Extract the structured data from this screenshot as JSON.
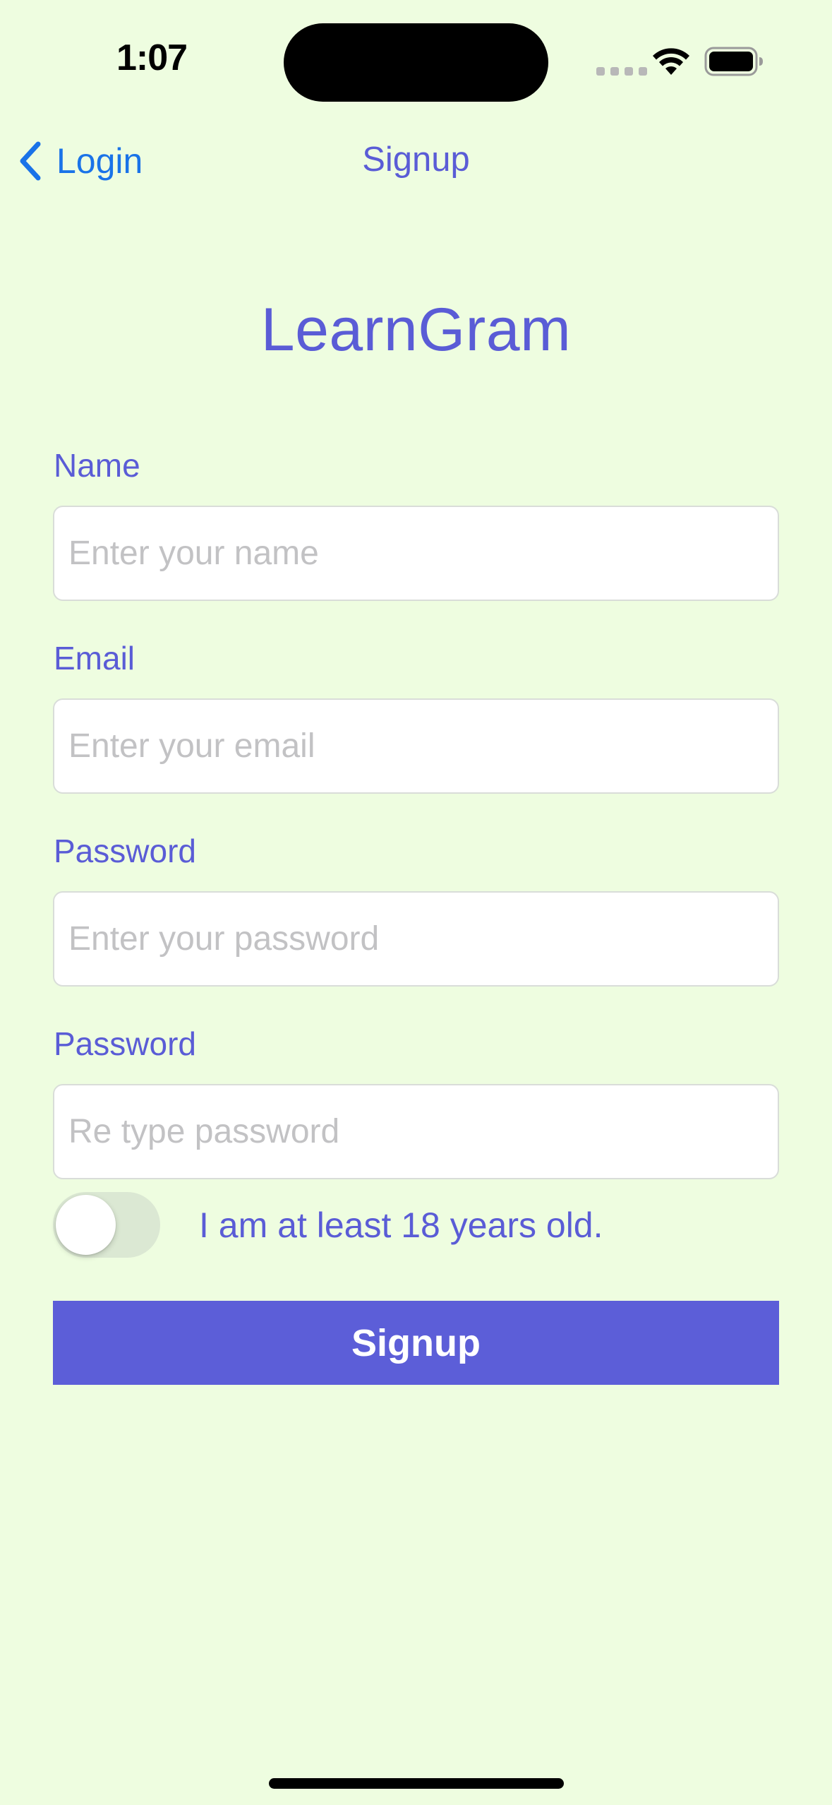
{
  "status_bar": {
    "time": "1:07",
    "icons": [
      "signal-icon",
      "wifi-icon",
      "battery-icon"
    ]
  },
  "nav": {
    "back_label": "Login",
    "title": "Signup"
  },
  "app_title": "LearnGram",
  "form": {
    "name": {
      "label": "Name",
      "placeholder": "Enter your name",
      "value": ""
    },
    "email": {
      "label": "Email",
      "placeholder": "Enter your email",
      "value": ""
    },
    "password": {
      "label": "Password",
      "placeholder": "Enter your password",
      "value": ""
    },
    "confirm_password": {
      "label": "Password",
      "placeholder": "Re type password",
      "value": ""
    },
    "age_toggle": {
      "label": "I am at least 18 years old.",
      "on": false
    },
    "submit_label": "Signup"
  },
  "colors": {
    "background": "#eefde0",
    "accent": "#5a5cd6",
    "button": "#5c5ed8",
    "link": "#1a73e8",
    "placeholder": "#c2c2c4"
  }
}
